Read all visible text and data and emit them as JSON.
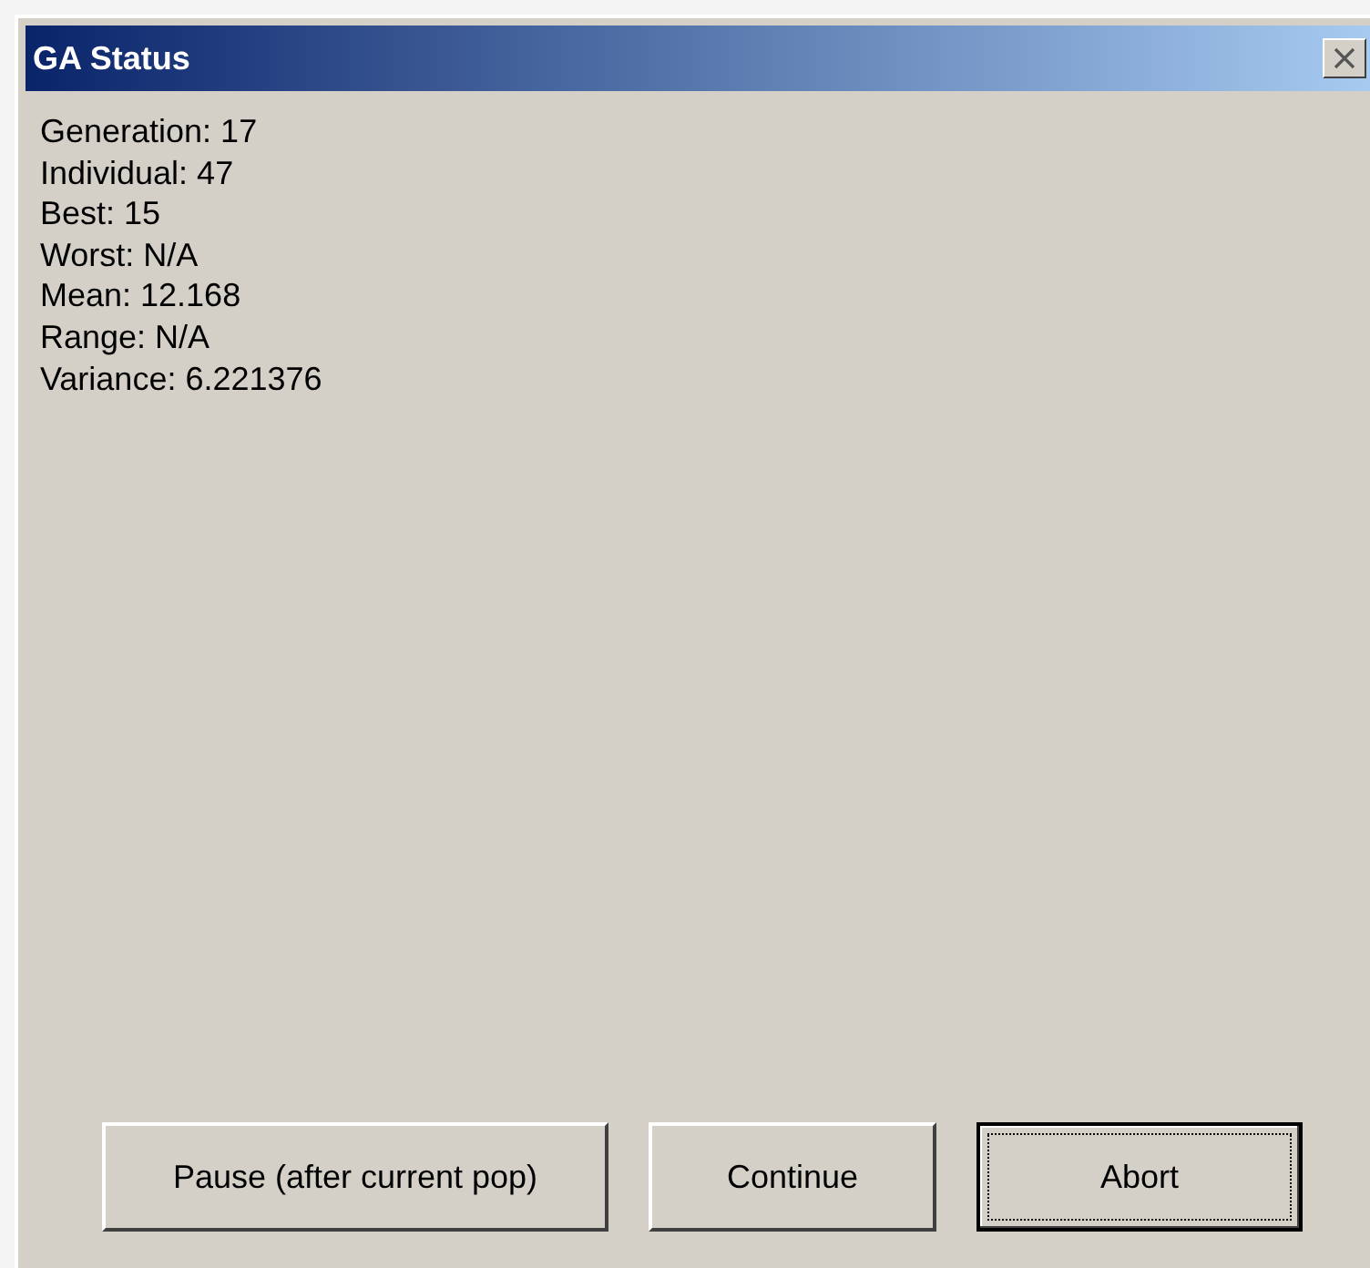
{
  "window": {
    "title": "GA Status"
  },
  "stats": [
    "Generation: 17",
    "Individual: 47",
    "Best: 15",
    "Worst: N/A",
    "Mean: 12.168",
    "Range: N/A",
    "Variance: 6.221376"
  ],
  "buttons": [
    {
      "label": "Pause (after current pop)",
      "focused": false
    },
    {
      "label": "Continue",
      "focused": false
    },
    {
      "label": "Abort",
      "focused": true
    }
  ]
}
